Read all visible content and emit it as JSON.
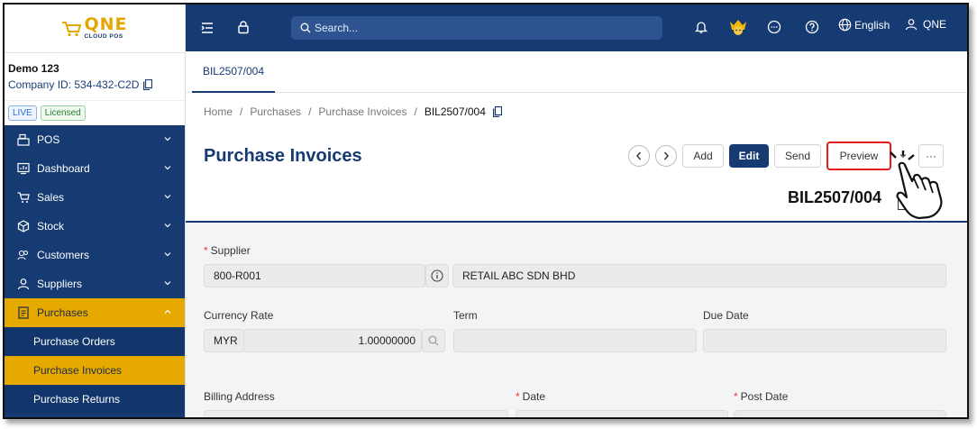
{
  "brand": {
    "logo_text": "QNE",
    "logo_sub": "CLOUD POS"
  },
  "company": {
    "name": "Demo 123",
    "id_text": "Company ID: 534-432-C2D"
  },
  "badges": {
    "live": "LIVE",
    "licensed": "Licensed"
  },
  "nav": {
    "items": [
      {
        "label": "POS",
        "icon": "register-icon"
      },
      {
        "label": "Dashboard",
        "icon": "dashboard-icon"
      },
      {
        "label": "Sales",
        "icon": "cart-icon"
      },
      {
        "label": "Stock",
        "icon": "box-icon"
      },
      {
        "label": "Customers",
        "icon": "customers-icon"
      },
      {
        "label": "Suppliers",
        "icon": "user-icon"
      },
      {
        "label": "Purchases",
        "icon": "document-icon"
      }
    ],
    "sub_items": [
      "Purchase Orders",
      "Purchase Invoices",
      "Purchase Returns"
    ],
    "active_item": "Purchases",
    "active_sub_item": "Purchase Invoices"
  },
  "topbar": {
    "search_placeholder": "Search...",
    "language": "English",
    "user": "QNE"
  },
  "tabs": [
    "BIL2507/004"
  ],
  "breadcrumb": {
    "home": "Home",
    "purchases": "Purchases",
    "section": "Purchase Invoices",
    "current": "BIL2507/004"
  },
  "page": {
    "title": "Purchase Invoices",
    "doc_number": "BIL2507/004"
  },
  "actions": {
    "add": "Add",
    "edit": "Edit",
    "send": "Send",
    "preview": "Preview",
    "more": "···"
  },
  "form": {
    "supplier_label": "Supplier",
    "supplier_code": "800-R001",
    "supplier_name": "RETAIL ABC SDN BHD",
    "currency_rate_label": "Currency Rate",
    "currency": "MYR",
    "rate": "1.00000000",
    "term_label": "Term",
    "due_date_label": "Due Date",
    "billing_address_label": "Billing Address",
    "date_label": "Date",
    "post_date_label": "Post Date"
  },
  "colors": {
    "navy": "#163a72",
    "accent": "#e6a900",
    "required": "#e53935",
    "highlight": "#e31b1b"
  }
}
